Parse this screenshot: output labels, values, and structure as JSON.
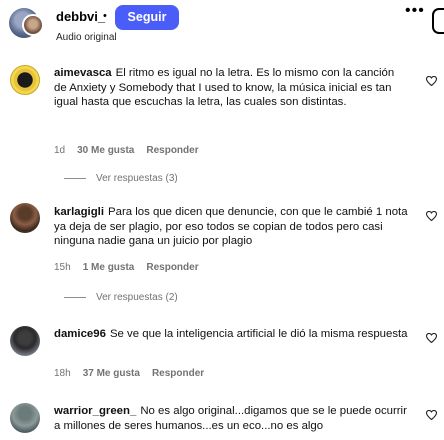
{
  "header": {
    "username": "debbvi_",
    "dot": "•",
    "follow_label": "Seguir",
    "audio_label": "Audio original",
    "more_label": "•••"
  },
  "comments": [
    {
      "username": "aimevasca",
      "text": "El ritmo es igual no la letra. Es lo mismo con la canción de Anxiety y Somebody that I used to know, la música inicial es tan igual hasta que escuchas la letra, las cuales son distintas.",
      "time": "1d",
      "likes": "30 Me gusta",
      "reply_label": "Responder",
      "replies": "Ver respuestas (3)"
    },
    {
      "username": "karlagigli",
      "text": "Para los que dicen que denuncie, con que le cambié 1 nota ya deja de ser plagio, por eso todos se copian de todos pero casi ninguna nadie gana un juicio por plagio",
      "time": "15h",
      "likes": "1 Me gusta",
      "reply_label": "Responder",
      "replies": "Ver respuestas (2)"
    },
    {
      "username": "damice96",
      "text": "Se ve que la inteligencia artificial le dió la misma respuesta",
      "time": "18h",
      "likes": "37 Me gusta",
      "reply_label": "Responder"
    },
    {
      "username": "warrior_green_",
      "text": "No es algo original...digamos que se le puede ocurrir a millones de seres humanos...es un eco...no es algo"
    }
  ],
  "colors": {
    "follow_button": "#4a5df9",
    "meta_text": "#737373"
  },
  "icons": [
    "avatar",
    "heart-icon",
    "more-icon"
  ]
}
